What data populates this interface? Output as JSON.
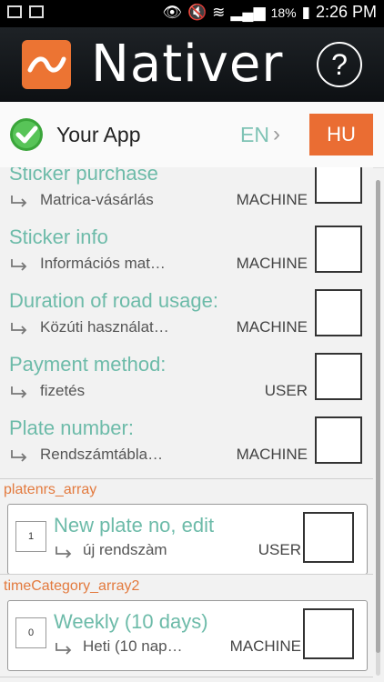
{
  "status_bar": {
    "battery": "18%",
    "time": "2:26 PM"
  },
  "header": {
    "brand": "Nativer",
    "help_label": "?"
  },
  "app_row": {
    "app_name": "Your App",
    "source_lang": "EN",
    "target_lang": "HU"
  },
  "rows": [
    {
      "title": "Sticker purchase",
      "translation": "Matrica-vásárlás",
      "role": "MACHINE"
    },
    {
      "title": "Sticker info",
      "translation": "Információs mat…",
      "role": "MACHINE"
    },
    {
      "title": "Duration of road usage:",
      "translation": "Közúti használat…",
      "role": "MACHINE"
    },
    {
      "title": "Payment method:",
      "translation": "fizetés",
      "role": "USER"
    },
    {
      "title": "Plate number:",
      "translation": "Rendszámtábla…",
      "role": "MACHINE"
    }
  ],
  "sections": [
    {
      "label": "platenrs_array",
      "card": {
        "index": "1",
        "title": "New plate no, edit",
        "translation": "új rendszàm",
        "role": "USER"
      }
    },
    {
      "label": "timeCategory_array2",
      "card": {
        "index": "0",
        "title": "Weekly (10 days)",
        "translation": "Heti (10 nap…",
        "role": "MACHINE"
      }
    }
  ],
  "colors": {
    "accent_orange": "#ea6d33",
    "text_teal": "#6dbba9",
    "section_orange": "#e37a3e"
  }
}
